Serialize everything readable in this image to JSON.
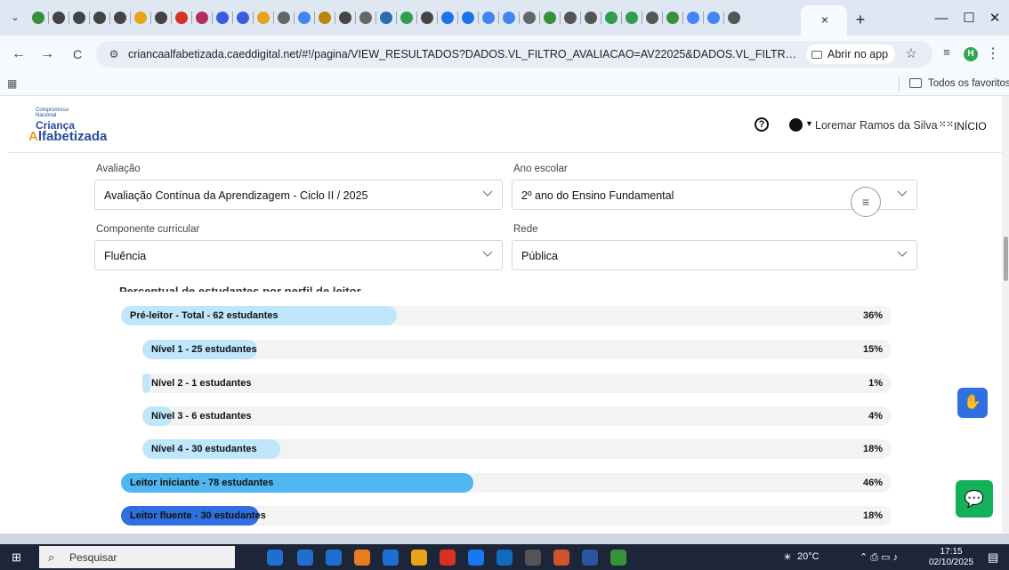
{
  "browser": {
    "tab_overflow_icon": "chevron-down-icon",
    "favicon_colors": [
      "#3a8f3a",
      "#444",
      "#444",
      "#444",
      "#444",
      "#e8a317",
      "#444",
      "#d93025",
      "#b03060",
      "#3b5bdb",
      "#3b5bdb",
      "#e8a317",
      "#666",
      "#4285f4",
      "#b8860b",
      "#444",
      "#666",
      "#2b6cb0",
      "#2e9e4f",
      "#444",
      "#1a73e8",
      "#1a73e8",
      "#4285f4",
      "#4285f4",
      "#666",
      "#3a8f3a",
      "#555",
      "#555",
      "#2e9e4f",
      "#2e9e4f",
      "#555",
      "#3a8f3a",
      "#4285f4",
      "#4285f4",
      "#555"
    ],
    "close_tab_label": "×",
    "new_tab_label": "+",
    "minimize_label": "—",
    "maximize_label": "☐",
    "close_window_label": "✕",
    "back_label": "←",
    "forward_label": "→",
    "reload_label": "C",
    "url": "criancaalfabetizada.caeddigital.net/#!/pagina/VIEW_RESULTADOS?DADOS.VL_FILTRO_AVALIACAO=AV22025&DADOS.VL_FILTRO_ETAPA=ENSINO...",
    "open_app_label": "Abrir no app",
    "profile_initial": "H",
    "all_favorites_label": "Todos os favoritos"
  },
  "site": {
    "logo_small": "Compromisso Nacional",
    "logo_line1": "Criança",
    "logo_line2_initial": "A",
    "logo_line2_rest": "lfabetizada",
    "help_glyph": "?",
    "user_name": "Loremar Ramos da Silva",
    "home_label": "INÍCIO"
  },
  "filters": {
    "avaliacao_label": "Avaliação",
    "avaliacao_value": "Avaliação Contínua da Aprendizagem - Ciclo II / 2025",
    "ano_label": "Ano escolar",
    "ano_value": "2º ano do Ensino Fundamental",
    "componente_label": "Componente curricular",
    "componente_value": "Fluência",
    "rede_label": "Rede",
    "rede_value": "Pública"
  },
  "chart_data": {
    "type": "bar",
    "title": "Percentual de estudantes por perfil de leitor",
    "categories": [
      "Pré-leitor - Total - 62 estudantes",
      "Nível 1 - 25 estudantes",
      "Nível 2 - 1 estudantes",
      "Nível 3 - 6 estudantes",
      "Nível 4 - 30 estudantes",
      "Leitor iniciante - 78 estudantes",
      "Leitor fluente - 30 estudantes"
    ],
    "values": [
      36,
      15,
      1,
      4,
      18,
      46,
      18
    ],
    "value_labels": [
      "36%",
      "15%",
      "1%",
      "4%",
      "18%",
      "46%",
      "18%"
    ],
    "ylim": [
      0,
      100
    ],
    "colors": {
      "pre_leitor": "#bfe6fb",
      "nivel": "#bfe6fb",
      "iniciante": "#4fb6f0",
      "fluente": "#2f6fe0",
      "track": "#f3f3f3"
    }
  },
  "taskbar": {
    "search_placeholder": "Pesquisar",
    "weather": "20°C",
    "time": "17:15",
    "date": "02/10/2025",
    "app_colors": [
      "#1f6fd1",
      "#1f6fd1",
      "#1f6fd1",
      "#e97c1d",
      "#1f6fd1",
      "#e8a317",
      "#d93025",
      "#1877f2",
      "#0f6cbd",
      "#555",
      "#d35230",
      "#2b579a",
      "#3a8f3a"
    ]
  }
}
